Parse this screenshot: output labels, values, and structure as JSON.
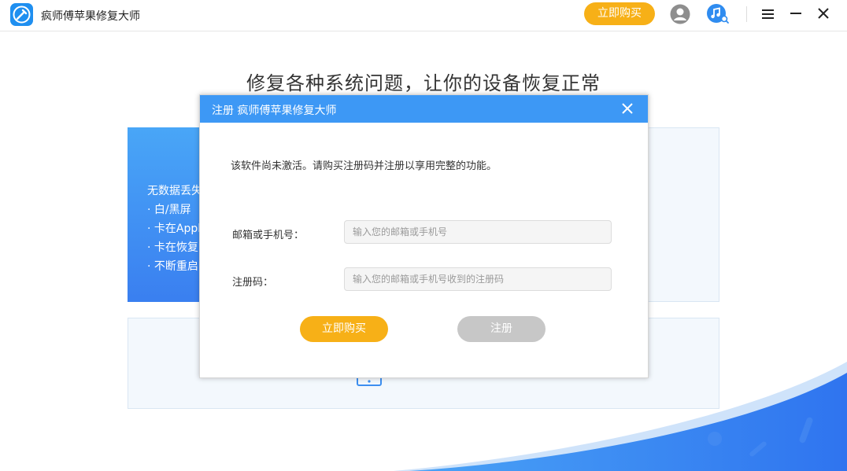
{
  "app": {
    "title": "疯师傅苹果修复大师",
    "buy_label": "立即购买"
  },
  "page": {
    "headline": "修复各种系统问题，让你的设备恢复正常",
    "features": [
      "无数据丢失",
      "· 白/黑屏",
      "· 卡在Apple",
      "· 卡在恢复",
      "· 不断重启"
    ]
  },
  "dialog": {
    "title": "注册 疯师傅苹果修复大师",
    "message": "该软件尚未激活。请购买注册码并注册以享用完整的功能。",
    "email_label": "邮箱或手机号：",
    "email_placeholder": "输入您的邮箱或手机号",
    "code_label": "注册码：",
    "code_placeholder": "输入您的邮箱或手机号收到的注册码",
    "buy_label": "立即购买",
    "register_label": "注册"
  },
  "colors": {
    "accent_orange": "#f7b017",
    "dialog_header": "#3d98f5",
    "disabled_gray": "#c7c7c7"
  },
  "icons": [
    "app-logo-icon",
    "user-icon",
    "music-search-icon",
    "menu-icon",
    "minimize-icon",
    "close-icon"
  ]
}
